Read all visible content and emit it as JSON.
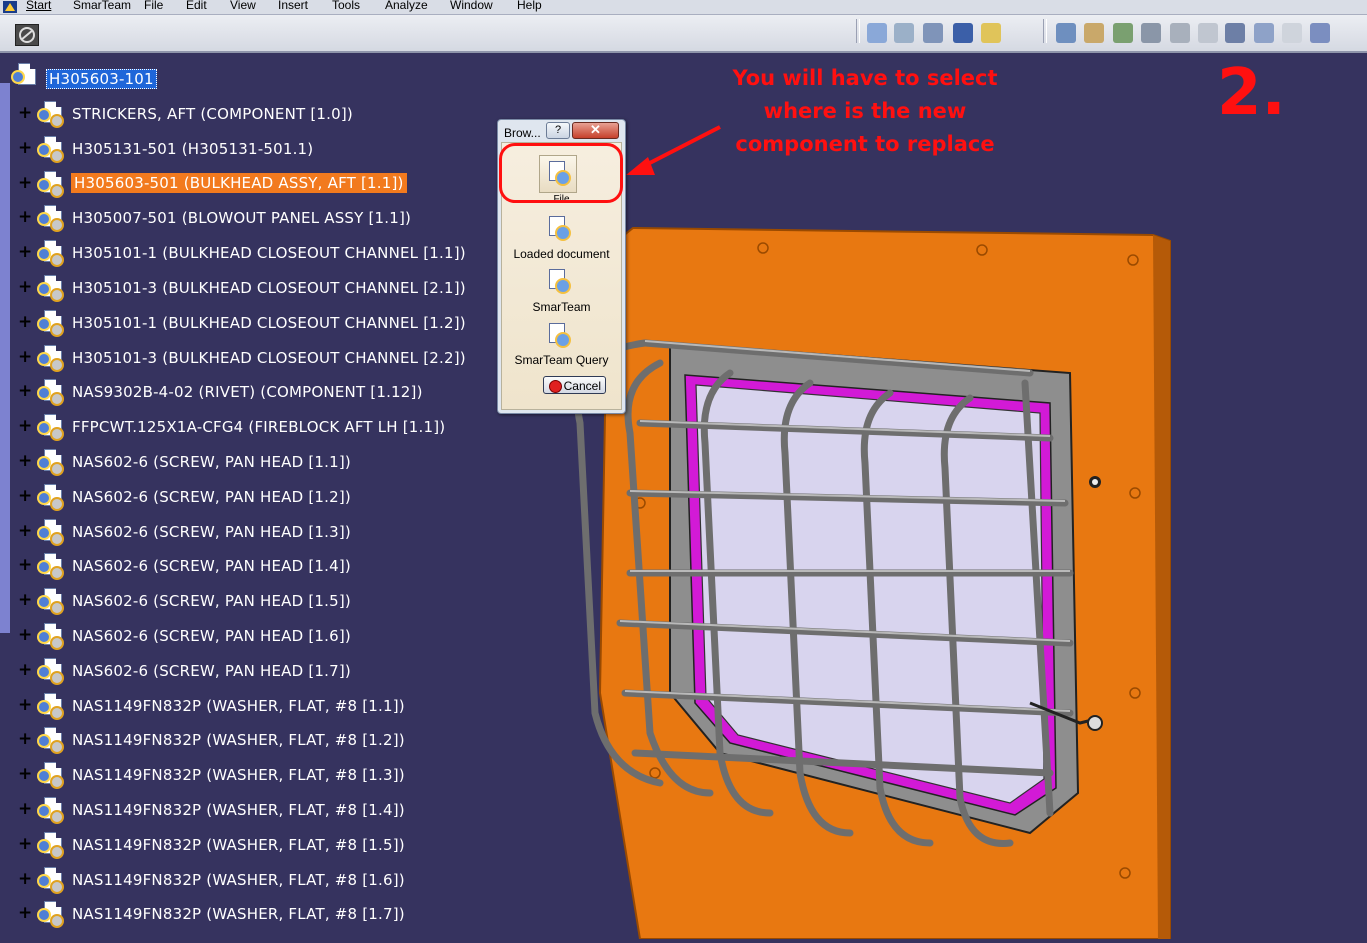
{
  "menu": {
    "items": [
      "Start",
      "SmarTeam",
      "File",
      "Edit",
      "View",
      "Insert",
      "Tools",
      "Analyze",
      "Window",
      "Help"
    ]
  },
  "tree": {
    "root": "H305603-101",
    "nodes": [
      "STRICKERS, AFT (COMPONENT   [1.0])",
      "H305131-501 (H305131-501.1)",
      "H305603-501 (BULKHEAD ASSY, AFT  [1.1])",
      "H305007-501 (BLOWOUT PANEL ASSY  [1.1])",
      "H305101-1 (BULKHEAD CLOSEOUT CHANNEL  [1.1])",
      "H305101-3 (BULKHEAD CLOSEOUT CHANNEL  [2.1])",
      "H305101-1 (BULKHEAD CLOSEOUT CHANNEL  [1.2])",
      "H305101-3 (BULKHEAD CLOSEOUT CHANNEL  [2.2])",
      "NAS9302B-4-02 (RIVET) (COMPONENT   [1.12])",
      "FFPCWT.125X1A-CFG4 (FIREBLOCK AFT LH  [1.1])",
      "NAS602-6 (SCREW, PAN HEAD  [1.1])",
      "NAS602-6 (SCREW, PAN HEAD  [1.2])",
      "NAS602-6 (SCREW, PAN HEAD  [1.3])",
      "NAS602-6 (SCREW, PAN HEAD  [1.4])",
      "NAS602-6 (SCREW, PAN HEAD  [1.5])",
      "NAS602-6 (SCREW, PAN HEAD  [1.6])",
      "NAS602-6 (SCREW, PAN HEAD  [1.7])",
      "NAS1149FN832P (WASHER, FLAT, #8  [1.1])",
      "NAS1149FN832P (WASHER, FLAT, #8  [1.2])",
      "NAS1149FN832P (WASHER, FLAT, #8  [1.3])",
      "NAS1149FN832P (WASHER, FLAT, #8  [1.4])",
      "NAS1149FN832P (WASHER, FLAT, #8  [1.5])",
      "NAS1149FN832P (WASHER, FLAT, #8  [1.6])",
      "NAS1149FN832P (WASHER, FLAT, #8  [1.7])"
    ],
    "selected_index": 2
  },
  "dialog": {
    "title": "Brow...",
    "help_label": "?",
    "close_label": "✕",
    "options": [
      "File",
      "Loaded document",
      "SmarTeam",
      "SmarTeam Query"
    ],
    "cancel_label": "Cancel"
  },
  "annotation": {
    "lines": [
      "You will have to select",
      "where is the new",
      "component to replace"
    ],
    "step": "2."
  },
  "colors": {
    "background": "#36335f",
    "selection": "#f27a1e",
    "annotation": "#ff1010",
    "plate": "#e87811",
    "frame": "#8e8e8e",
    "seal": "#d21ad6",
    "window": "#d8d4ee"
  }
}
